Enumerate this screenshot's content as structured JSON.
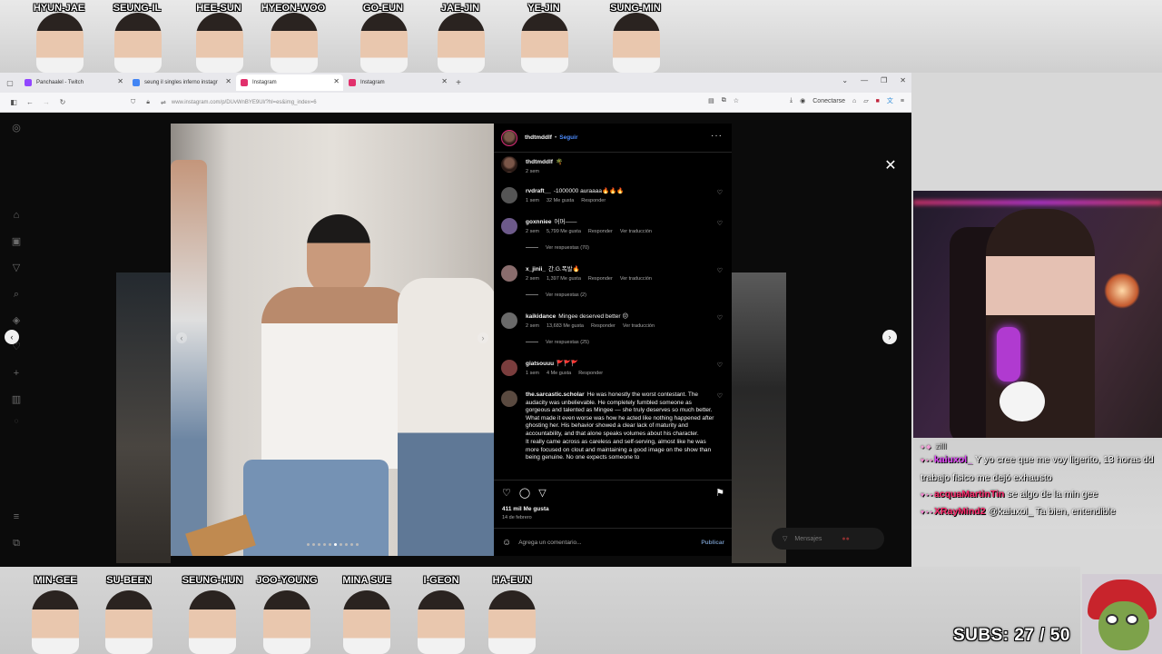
{
  "cast_top": [
    "HYUN-JAE",
    "SEUNG-IL",
    "HEE-SUN",
    "HYEON-WOO",
    "GO-EUN",
    "JAE-JIN",
    "YE-JIN",
    "SUNG-MIN"
  ],
  "cast_bottom": [
    "MIN-GEE",
    "SU-BEEN",
    "SEUNG-HUN",
    "JOO-YOUNG",
    "MINA SUE",
    "I-GEON",
    "HA-EUN"
  ],
  "browser": {
    "tabs": [
      {
        "label": "Panchaalel - Twitch",
        "active": false,
        "color": "#9146ff"
      },
      {
        "label": "seung il singles inferno instagr",
        "active": false,
        "color": "#4285f4"
      },
      {
        "label": "Instagram",
        "active": true,
        "color": "#e1306c"
      },
      {
        "label": "Instagram",
        "active": false,
        "color": "#e1306c"
      }
    ],
    "url": "www.instagram.com/p/DUvWnBYE9Ul/?hl=es&img_index=6",
    "sign_in_label": "Conectarse"
  },
  "instagram": {
    "post_user": "thdtmddlf",
    "follow_label": "Seguir",
    "caption": {
      "user": "thdtmddlf",
      "text": "🌴",
      "time": "2 sem"
    },
    "comments": [
      {
        "user": "rvdraft__",
        "text": "-1000000 auraaaa🔥🔥🔥",
        "time": "1 sem",
        "likes": "32 Me gusta",
        "reply": "Responder",
        "translate": "",
        "replies": ""
      },
      {
        "user": "goxnniee",
        "text": "어머——",
        "time": "2 sem",
        "likes": "5,799 Me gusta",
        "reply": "Responder",
        "translate": "Ver traducción",
        "replies": "Ver respuestas (70)"
      },
      {
        "user": "x_jinii_",
        "text": "간.G.폭발🔥",
        "time": "2 sem",
        "likes": "1,397 Me gusta",
        "reply": "Responder",
        "translate": "Ver traducción",
        "replies": "Ver respuestas (2)"
      },
      {
        "user": "kaikidance",
        "text": "Mingee deserved better 😔",
        "time": "2 sem",
        "likes": "13,683 Me gusta",
        "reply": "Responder",
        "translate": "Ver traducción",
        "replies": "Ver respuestas (25)"
      },
      {
        "user": "giatsouuu",
        "text": "🚩🚩🚩",
        "time": "1 sem",
        "likes": "4 Me gusta",
        "reply": "Responder",
        "translate": "",
        "replies": ""
      },
      {
        "user": "the.sarcastic.scholar",
        "text": "He was honestly the worst contestant. The audacity was unbelievable. He completely fumbled someone as gorgeous and talented as Mingee — she truly deserves so much better. What made it even worse was how he acted like nothing happened after ghosting her. His behavior showed a clear lack of maturity and accountability, and that alone speaks volumes about his character.",
        "text2": "It really came across as careless and self-serving, almost like he was more focused on clout and maintaining a good image on the show than being genuine. No one expects someone to"
      }
    ],
    "likes_total": "411 mil Me gusta",
    "post_date": "14 de febrero",
    "comment_placeholder": "Agrega un comentario...",
    "publish_label": "Publicar",
    "messages_label": "Mensajes"
  },
  "chat": [
    {
      "nick": "kaiuxol_",
      "nick_color": "#e040fb",
      "text": "Y yo cree que me voy ligerito, 13 horas dd trabajo fisico me dejó exhausto"
    },
    {
      "nick": "acquaMartinTin",
      "nick_color": "#ff2a6d",
      "text": "se algo de la min gee"
    },
    {
      "nick": "XRayMind2",
      "nick_color": "#ff2a6d",
      "text": "@kaiuxol_ Ta bien, entendible"
    }
  ],
  "chat_faded_nick": "zilll",
  "subs": "SUBS: 27 / 50"
}
